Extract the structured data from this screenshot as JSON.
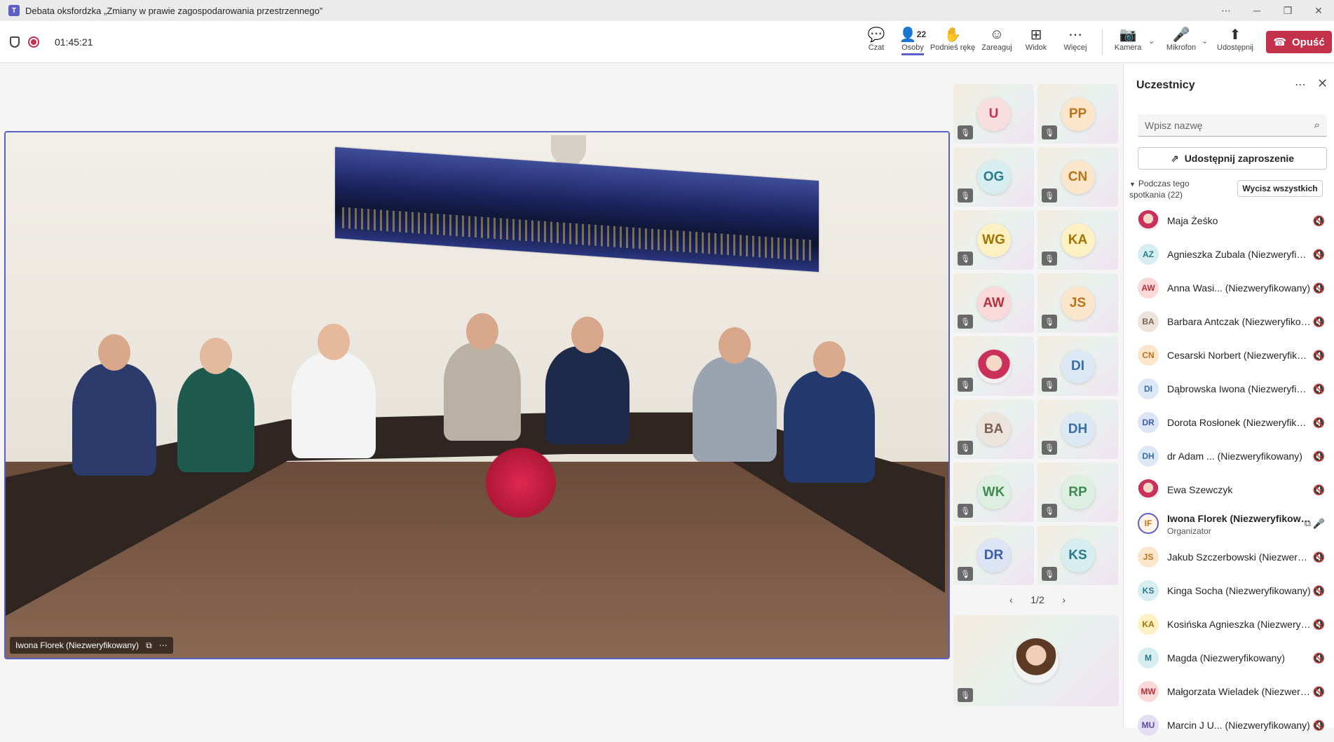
{
  "window": {
    "title": "Debata oksfordzka „Zmiany w prawie zagospodarowania przestrzennego”",
    "app_icon": "teams-icon"
  },
  "toolbar": {
    "timer": "01:45:21",
    "people_count": "22",
    "chat": "Czat",
    "people": "Osoby",
    "raise_hand": "Podnieś rękę",
    "react": "Zareaguj",
    "view": "Widok",
    "more": "Więcej",
    "camera": "Kamera",
    "mic": "Mikrofon",
    "share": "Udostępnij",
    "leave": "Opuść",
    "accent": "#5b5fc7",
    "leave_color": "#c4314b"
  },
  "stage": {
    "speaker_name": "Iwona Florek (Niezweryfikowany)"
  },
  "grid": {
    "tiles": [
      {
        "initials": "U",
        "color": "#c4314b",
        "bg": "#f9dedf"
      },
      {
        "initials": "PP",
        "color": "#b8741a",
        "bg": "#fbe6cc"
      },
      {
        "initials": "OG",
        "color": "#2b7a8a",
        "bg": "#d6eef0"
      },
      {
        "initials": "CN",
        "color": "#b8741a",
        "bg": "#fbe6cc"
      },
      {
        "initials": "WG",
        "color": "#a07400",
        "bg": "#fdf0c2"
      },
      {
        "initials": "KA",
        "color": "#a07400",
        "bg": "#fdf0c2"
      },
      {
        "initials": "AW",
        "color": "#b0343d",
        "bg": "#f9d9d9"
      },
      {
        "initials": "JS",
        "color": "#b8741a",
        "bg": "#fbe6cc"
      },
      {
        "initials": "",
        "photo": true
      },
      {
        "initials": "DI",
        "color": "#3a6ea5",
        "bg": "#dce9f5"
      },
      {
        "initials": "BA",
        "color": "#7a6050",
        "bg": "#ece3dc"
      },
      {
        "initials": "DH",
        "color": "#3a6ea5",
        "bg": "#dce9f5"
      },
      {
        "initials": "WK",
        "color": "#3f8a52",
        "bg": "#dcefe0"
      },
      {
        "initials": "RP",
        "color": "#3f8a52",
        "bg": "#dcefe0"
      },
      {
        "initials": "DR",
        "color": "#3a5ea5",
        "bg": "#dce4f5"
      },
      {
        "initials": "KS",
        "color": "#2b7a8a",
        "bg": "#d6eef0"
      }
    ],
    "pager": "1/2"
  },
  "panel": {
    "title": "Uczestnicy",
    "search_placeholder": "Wpisz nazwę",
    "invite": "Udostępnij zaproszenie",
    "section": "Podczas tego spotkania (22)",
    "mute_all": "Wycisz wszystkich",
    "participants": [
      {
        "initials": "",
        "name": "Maja Żeśko",
        "photo": true,
        "bg": "#f5f5f5",
        "color": "#333"
      },
      {
        "initials": "AZ",
        "name": "Agnieszka Zubala (Niezweryfikowany)",
        "bg": "#d6eef0",
        "color": "#2b7a8a"
      },
      {
        "initials": "AW",
        "name": "Anna Wasi... (Niezweryfikowany)",
        "bg": "#f9d9d9",
        "color": "#b0343d"
      },
      {
        "initials": "BA",
        "name": "Barbara Antczak (Niezweryfikowany)",
        "bg": "#ece3dc",
        "color": "#7a6050"
      },
      {
        "initials": "CN",
        "name": "Cesarski Norbert (Niezweryfikowany)",
        "bg": "#fbe6cc",
        "color": "#b8741a"
      },
      {
        "initials": "DI",
        "name": "Dąbrowska Iwona (Niezweryfikowany)",
        "bg": "#dce9f5",
        "color": "#3a6ea5"
      },
      {
        "initials": "DR",
        "name": "Dorota Rosłonek (Niezweryfikowany)",
        "bg": "#dce4f5",
        "color": "#3a5ea5"
      },
      {
        "initials": "DH",
        "name": "dr Adam ...  (Niezweryfikowany)",
        "bg": "#dce9f5",
        "color": "#3a6ea5"
      },
      {
        "initials": "",
        "name": "Ewa Szewczyk",
        "photo": true,
        "bg": "#f5f5f5",
        "color": "#333"
      },
      {
        "initials": "IF",
        "name": "Iwona Florek (Niezweryfikowany)",
        "role": "Organizator",
        "organizer": true,
        "bg": "#fff3e6",
        "color": "#b8741a"
      },
      {
        "initials": "JS",
        "name": "Jakub Szczerbowski (Niezweryfikowany)",
        "bg": "#fbe6cc",
        "color": "#b8741a"
      },
      {
        "initials": "KS",
        "name": "Kinga Socha (Niezweryfikowany)",
        "bg": "#d6eef0",
        "color": "#2b7a8a"
      },
      {
        "initials": "KA",
        "name": "Kosińska Agnieszka (Niezweryfikowany)",
        "bg": "#fdf0c2",
        "color": "#a07400"
      },
      {
        "initials": "M",
        "name": "Magda (Niezweryfikowany)",
        "bg": "#d6eef0",
        "color": "#2b7a8a"
      },
      {
        "initials": "MW",
        "name": "Małgorzata Wieladek (Niezweryfikowany)",
        "bg": "#f9d9d9",
        "color": "#b0343d"
      },
      {
        "initials": "MU",
        "name": "Marcin J U... (Niezweryfikowany)",
        "bg": "#e4def5",
        "color": "#5b4a9a"
      }
    ]
  }
}
